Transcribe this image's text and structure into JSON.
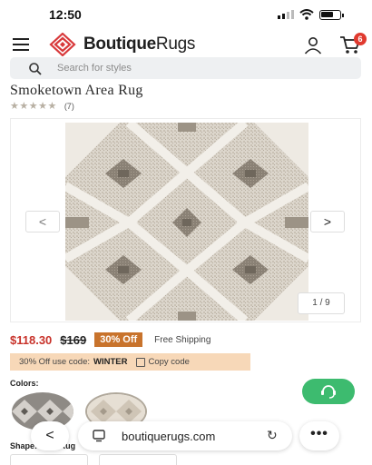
{
  "status_bar": {
    "time": "12:50"
  },
  "header": {
    "logo_text_bold": "Boutique",
    "logo_text_light": "Rugs",
    "cart_count": "6"
  },
  "search": {
    "placeholder": "Search for styles"
  },
  "product": {
    "title": "Smoketown Area Rug",
    "stars": "★★★★★",
    "review_count": "(7)",
    "gallery_counter": "1 / 9",
    "price": "$118.30",
    "old_price": "$169",
    "discount": "30% Off",
    "shipping": "Free Shipping",
    "promo_text": "30% Off use code:",
    "promo_code": "WINTER",
    "copy_label": "Copy code",
    "colors_label": "Colors:",
    "shape_label": "Shape: Area Rug"
  },
  "browser": {
    "url": "boutiquerugs.com",
    "back_glyph": "<",
    "reload_glyph": "↻",
    "more_glyph": "•••"
  },
  "gallery_nav": {
    "prev_glyph": "<",
    "next_glyph": ">"
  },
  "colors": {
    "brand": "#d8393b",
    "price": "#c8322a",
    "discount_bg": "#c8732c",
    "promo_bg": "#f7d8b8",
    "chat": "#3dbb6f"
  },
  "icons": [
    "menu-icon",
    "logo-icon",
    "user-icon",
    "cart-icon",
    "search-icon",
    "copy-icon",
    "chat-icon",
    "tabs-icon",
    "reload-icon"
  ]
}
